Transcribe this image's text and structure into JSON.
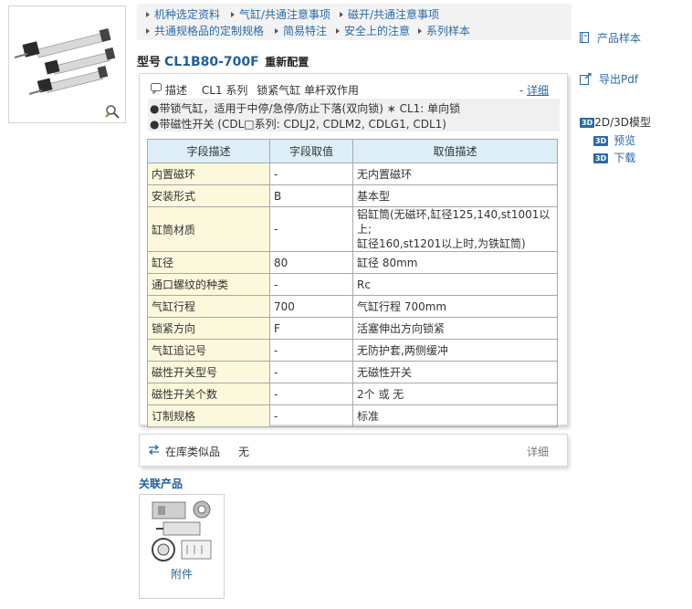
{
  "nav": {
    "row1": [
      "机种选定资料",
      "气缸/共通注意事项",
      "磁开/共通注意事项"
    ],
    "row2": [
      "共通规格品的定制规格",
      "简易特注",
      "安全上的注意",
      "系列样本"
    ]
  },
  "title": {
    "prefix": "型号",
    "model": "CL1B80-700F",
    "reconfigure": "重新配置"
  },
  "description": {
    "label": "描述",
    "series": "CL1 系列",
    "name": "锁紧气缸 单杆双作用",
    "detail_prefix": "-",
    "detail_link": "详细",
    "note1": "●带锁气缸，适用于中停/急停/防止下落(双向锁) ∗ CL1: 单向锁",
    "note2": "●带磁性开关 (CDL□系列: CDLJ2, CDLM2, CDLG1, CDL1)"
  },
  "table": {
    "headers": [
      "字段描述",
      "字段取值",
      "取值描述"
    ],
    "rows": [
      [
        "内置磁环",
        "-",
        "无内置磁环"
      ],
      [
        "安装形式",
        "B",
        "基本型"
      ],
      [
        "缸筒材质",
        "-",
        "铝缸筒(无磁环,缸径125,140,st1001以上;",
        "缸径160,st1201以上时,为铁缸筒)"
      ],
      [
        "缸径",
        "80",
        "缸径 80mm"
      ],
      [
        "通口螺纹的种类",
        "-",
        "Rc"
      ],
      [
        "气缸行程",
        "700",
        "气缸行程 700mm"
      ],
      [
        "锁紧方向",
        "F",
        "活塞伸出方向锁紧"
      ],
      [
        "气缸追记号",
        "-",
        "无防护套,两侧缓冲"
      ],
      [
        "磁性开关型号",
        "-",
        "无磁性开关"
      ],
      [
        "磁性开关个数",
        "-",
        "2个 或 无"
      ],
      [
        "订制规格",
        "-",
        "标准"
      ]
    ]
  },
  "stock": {
    "label": "在库类似品",
    "value": "无",
    "detail": "详细"
  },
  "related": {
    "title": "关联产品",
    "item_label": "附件"
  },
  "sidebar": {
    "catalog": "产品样本",
    "export_pdf": "导出Pdf",
    "model_title": "2D/3D模型",
    "badge": "3D",
    "preview": "预览",
    "download": "下载"
  },
  "colors": {
    "link": "#2a6aa8",
    "header_bg": "#ddeef8",
    "field_bg": "#fbf8dc"
  }
}
